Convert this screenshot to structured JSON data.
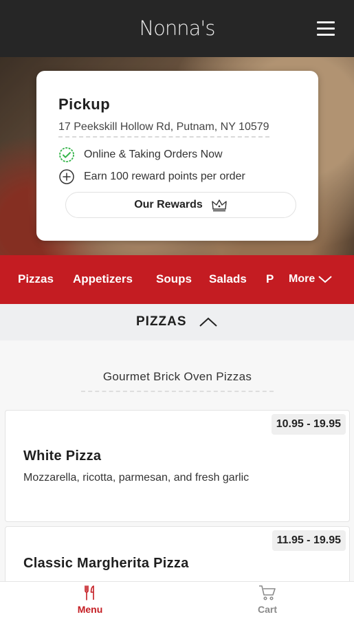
{
  "app": {
    "logo": "Nonna's"
  },
  "pickup": {
    "title": "Pickup",
    "address": "17 Peekskill Hollow Rd, Putnam, NY 10579",
    "status": "Online & Taking Orders Now",
    "rewards_info": "Earn 100 reward points per order",
    "rewards_button": "Our Rewards"
  },
  "categories": [
    "Pizzas",
    "Appetizers",
    "Soups",
    "Salads",
    "P"
  ],
  "more_label": "More",
  "section": {
    "title": "PIZZAS",
    "subheading": "Gourmet Brick Oven Pizzas"
  },
  "items": [
    {
      "name": "White Pizza",
      "price": "10.95 - 19.95",
      "description": "Mozzarella, ricotta, parmesan, and fresh garlic"
    },
    {
      "name": "Classic Margherita Pizza",
      "price": "11.95 - 19.95"
    }
  ],
  "bottom_nav": {
    "menu": "Menu",
    "cart": "Cart"
  },
  "colors": {
    "accent": "#c41c22",
    "topbar": "#262626",
    "success": "#35b44a"
  }
}
